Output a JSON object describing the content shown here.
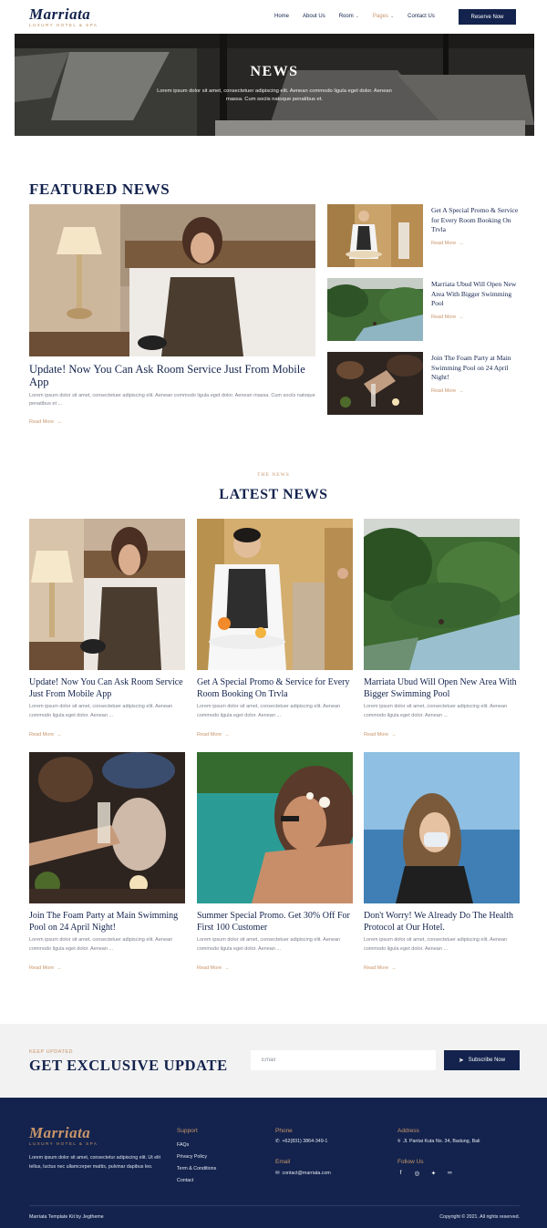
{
  "brand": {
    "name": "Marriata",
    "tagline": "LUXURY HOTEL & SPA"
  },
  "nav": {
    "items": [
      {
        "label": "Home",
        "dropdown": false
      },
      {
        "label": "About Us",
        "dropdown": false
      },
      {
        "label": "Room",
        "dropdown": true
      },
      {
        "label": "Pages",
        "dropdown": true,
        "active": true
      },
      {
        "label": "Contact Us",
        "dropdown": false
      }
    ],
    "cta": "Reserve Now"
  },
  "hero": {
    "title": "NEWS",
    "text": "Lorem ipsum dolor sit amet, consectetuer adipiscing elit. Aenean commodo ligula eget dolor. Aenean massa. Cum sociis natoque penatibus et."
  },
  "featured": {
    "heading": "FEATURED NEWS",
    "main": {
      "title": "Update! Now You Can Ask Room Service Just From Mobile App",
      "excerpt": "Lorem ipsum dolor sit amet, consectetuer adipiscing elit. Aenean commodo ligula eget dolor. Aenean massa. Cum sociis natoque penatibus et ...",
      "read_more": "Read More"
    },
    "side": [
      {
        "title": "Get A Special Promo & Service for Every Room Booking On Trvla",
        "read_more": "Read More"
      },
      {
        "title": "Marriata Ubud Will Open New Area With Bigger Swimming Pool",
        "read_more": "Read More"
      },
      {
        "title": "Join The Foam Party at Main Swimming Pool on 24 April Night!",
        "read_more": "Read More"
      }
    ]
  },
  "latest": {
    "eyebrow": "THE NEWS",
    "heading": "LATEST NEWS",
    "cards": [
      {
        "title": "Update! Now You Can Ask Room Service Just From Mobile App",
        "excerpt": "Lorem ipsum dolor sit amet, consectetuer adipiscing elit. Aenean commodo ligula eget dolor. Aenean ...",
        "read_more": "Read More"
      },
      {
        "title": "Get A Special Promo & Service for Every Room Booking On Trvla",
        "excerpt": "Lorem ipsum dolor sit amet, consectetuer adipiscing elit. Aenean commodo ligula eget dolor. Aenean ...",
        "read_more": "Read More"
      },
      {
        "title": "Marriata Ubud Will Open New Area With Bigger Swimming Pool",
        "excerpt": "Lorem ipsum dolor sit amet, consectetuer adipiscing elit. Aenean commodo ligula eget dolor. Aenean ...",
        "read_more": "Read More"
      },
      {
        "title": "Join The Foam Party at Main Swimming Pool on 24 April Night!",
        "excerpt": "Lorem ipsum dolor sit amet, consectetuer adipiscing elit. Aenean commodo ligula eget dolor. Aenean ...",
        "read_more": "Read More"
      },
      {
        "title": "Summer Special Promo. Get 30% Off For First 100 Customer",
        "excerpt": "Lorem ipsum dolor sit amet, consectetuer adipiscing elit. Aenean commodo ligula eget dolor. Aenean ...",
        "read_more": "Read More"
      },
      {
        "title": "Don't Worry! We Already Do The Health Protocol at Our Hotel.",
        "excerpt": "Lorem ipsum dolor sit amet, consectetuer adipiscing elit. Aenean commodo ligula eget dolor. Aenean ...",
        "read_more": "Read More"
      }
    ]
  },
  "subscribe": {
    "eyebrow": "KEEP UPDATED",
    "heading": "GET EXCLUSIVE UPDATE",
    "email_placeholder": "Email",
    "button": "Subscribe Now"
  },
  "footer": {
    "description": "Lorem ipsum dolor sit amet, consectetur adipiscing elit. Ut elit tellus, luctus nec ullamcorper mattis, pulvinar dapibus leo.",
    "support_heading": "Support",
    "support_links": [
      "FAQs",
      "Privacy Policy",
      "Term & Conditions",
      "Contact"
    ],
    "phone_heading": "Phone",
    "phone": "+62(831) 3864-349-1",
    "email_heading": "Email",
    "email": "contact@marriata.com",
    "address_heading": "Address",
    "address": "Jl. Pantai Kuta No. 34, Badung, Bali",
    "follow_heading": "Follow Us",
    "social": [
      "facebook-icon",
      "instagram-icon",
      "twitter-icon",
      "tripadvisor-icon"
    ],
    "credit": "Marriata Template Kit by Jegtheme",
    "copyright": "Copyright © 2021. All rights reserved."
  },
  "colors": {
    "navy": "#13234d",
    "accent": "#c9956a"
  }
}
